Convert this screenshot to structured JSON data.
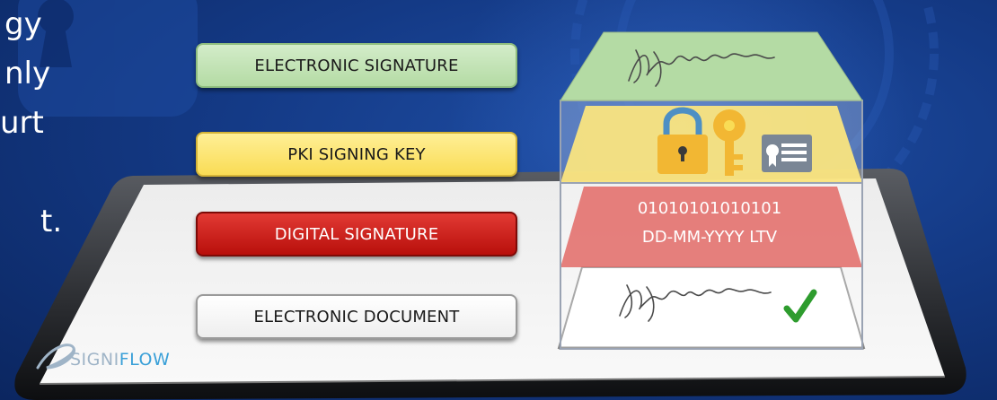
{
  "partial_text_lines": [
    "gy",
    "nly",
    "urt",
    "",
    "t."
  ],
  "labels": {
    "electronic_signature": "ELECTRONIC SIGNATURE",
    "pki_signing_key": "PKI SIGNING KEY",
    "digital_signature": "DIGITAL SIGNATURE",
    "electronic_document": "ELECTRONIC DOCUMENT"
  },
  "layers": {
    "digital_binary": "01010101010101",
    "digital_date_ltv": "DD-MM-YYYY LTV"
  },
  "logo": {
    "part1": "SIGNI",
    "part2": "FLOW"
  },
  "colors": {
    "background": "#143a86",
    "electronic_signature_layer": "#b4dba4",
    "pki_layer": "#f9dc55",
    "digital_signature_layer": "#d8312c",
    "document_layer": "#ffffff",
    "checkmark": "#2e9c2e",
    "logo_accent": "#3aa0d8"
  },
  "icons": [
    "padlock-icon",
    "key-icon",
    "certificate-icon",
    "checkmark-icon",
    "signature-icon",
    "keyhole-icon"
  ]
}
